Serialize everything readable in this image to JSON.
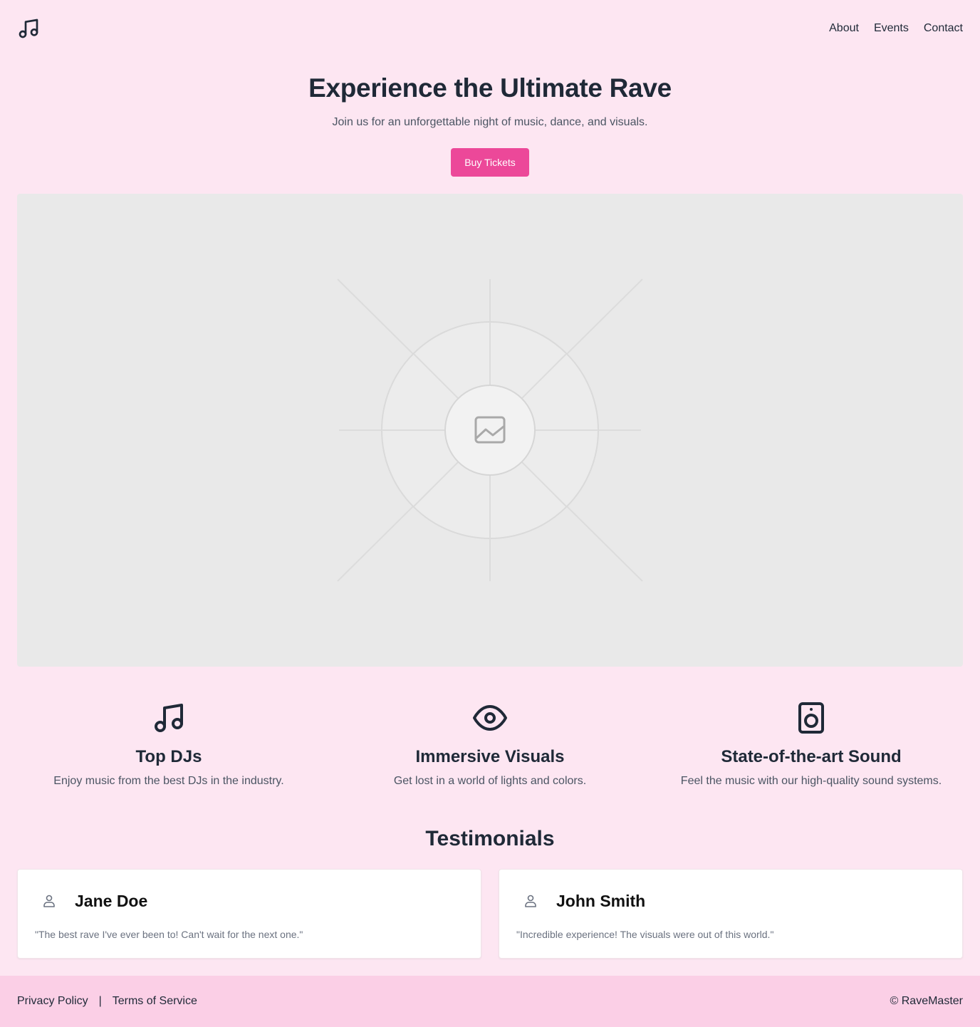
{
  "header": {
    "logo_icon": "music-note-icon",
    "nav": [
      {
        "label": "About"
      },
      {
        "label": "Events"
      },
      {
        "label": "Contact"
      }
    ]
  },
  "hero": {
    "title": "Experience the Ultimate Rave",
    "subtitle": "Join us for an unforgettable night of music, dance, and visuals.",
    "cta_label": "Buy Tickets",
    "image_icon": "image-placeholder-icon"
  },
  "features": [
    {
      "icon": "music-note-icon",
      "title": "Top DJs",
      "description": "Enjoy music from the best DJs in the industry."
    },
    {
      "icon": "eye-icon",
      "title": "Immersive Visuals",
      "description": "Get lost in a world of lights and colors."
    },
    {
      "icon": "speaker-icon",
      "title": "State-of-the-art Sound",
      "description": "Feel the music with our high-quality sound systems."
    }
  ],
  "testimonials": {
    "title": "Testimonials",
    "items": [
      {
        "icon": "user-icon",
        "name": "Jane Doe",
        "quote": "\"The best rave I've ever been to! Can't wait for the next one.\""
      },
      {
        "icon": "user-icon",
        "name": "John Smith",
        "quote": "\"Incredible experience! The visuals were out of this world.\""
      }
    ]
  },
  "footer": {
    "links": [
      {
        "label": "Privacy Policy"
      },
      {
        "label": "Terms of Service"
      }
    ],
    "separator": "|",
    "copyright": "© RaveMaster"
  },
  "colors": {
    "background": "#fde6f2",
    "footer_background": "#fbcfe6",
    "accent": "#ec4899",
    "text": "#1f2937"
  }
}
